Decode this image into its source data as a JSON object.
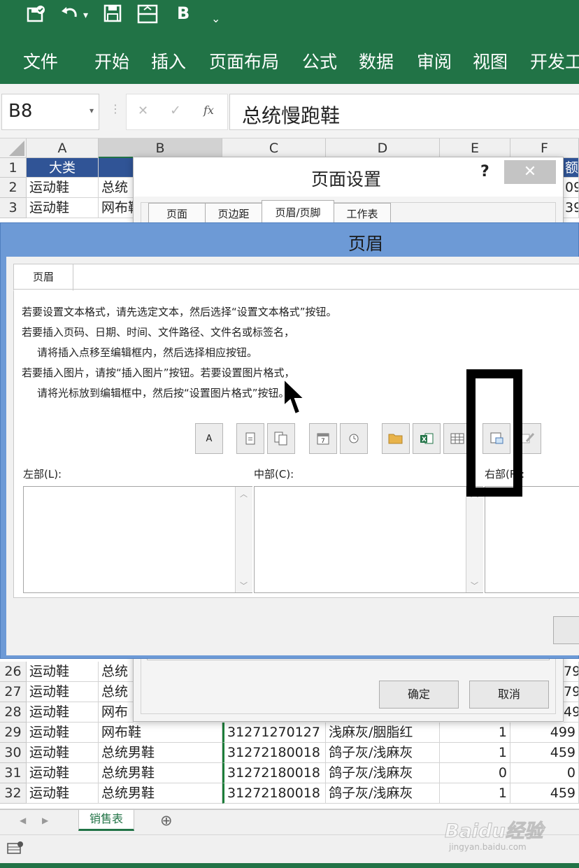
{
  "qat": {
    "save_icon": "save-icon",
    "undo_icon": "undo-icon",
    "bold_label": "B"
  },
  "ribbon": {
    "tabs": [
      "文件",
      "开始",
      "插入",
      "页面布局",
      "公式",
      "数据",
      "审阅",
      "视图",
      "开发工"
    ]
  },
  "formula_bar": {
    "name_box": "B8",
    "cancel": "✕",
    "enter": "✓",
    "fx": "fx",
    "value": "总统慢跑鞋"
  },
  "columns": [
    "A",
    "B",
    "C",
    "D",
    "E",
    "F"
  ],
  "rows_top": [
    {
      "n": "1",
      "a": "大类",
      "b": "",
      "f": "额"
    },
    {
      "n": "2",
      "a": "运动鞋",
      "b": "总统",
      "f": "09"
    },
    {
      "n": "3",
      "a": "运动鞋",
      "b": "网布鞋",
      "f": "39"
    }
  ],
  "rows_bottom": [
    {
      "n": "26",
      "a": "运动鞋",
      "b": "总统",
      "c": "",
      "d": "",
      "e": "",
      "f": "79"
    },
    {
      "n": "27",
      "a": "运动鞋",
      "b": "总统",
      "c": "",
      "d": "",
      "e": "",
      "f": "79"
    },
    {
      "n": "28",
      "a": "运动鞋",
      "b": "网布",
      "c": "",
      "d": "",
      "e": "",
      "f": "49"
    },
    {
      "n": "29",
      "a": "运动鞋",
      "b": "网布鞋",
      "c": "31271270127",
      "d": "浅麻灰/胭脂红",
      "e": "1",
      "f": "499"
    },
    {
      "n": "30",
      "a": "运动鞋",
      "b": "总统男鞋",
      "c": "31272180018",
      "d": "鸽子灰/浅麻灰",
      "e": "1",
      "f": "459"
    },
    {
      "n": "31",
      "a": "运动鞋",
      "b": "总统男鞋",
      "c": "31272180018",
      "d": "鸽子灰/浅麻灰",
      "e": "0",
      "f": "0"
    },
    {
      "n": "32",
      "a": "运动鞋",
      "b": "总统男鞋",
      "c": "31272180018",
      "d": "鸽子灰/浅麻灰",
      "e": "1",
      "f": "459"
    }
  ],
  "sheet_tabs": {
    "active": "销售表",
    "add": "⊕"
  },
  "page_setup": {
    "title": "页面设置",
    "help": "?",
    "close": "✕",
    "tabs": [
      "页面",
      "页边距",
      "页眉/页脚",
      "工作表"
    ],
    "ok": "确定",
    "cancel": "取消"
  },
  "header_dialog": {
    "title": "页眉",
    "tab": "页眉",
    "instructions": [
      "若要设置文本格式，请先选定文本，然后选择“设置文本格式”按钮。",
      "若要插入页码、日期、时间、文件路径、文件名或标签名，",
      "请将插入点移至编辑框内，然后选择相应按钮。",
      "若要插入图片，请按“插入图片”按钮。若要设置图片格式，",
      "请将光标放到编辑框中，然后按“设置图片格式”按钮。"
    ],
    "toolbar": [
      "format-text-icon",
      "page-number-icon",
      "page-count-icon",
      "date-icon",
      "time-icon",
      "file-path-icon",
      "file-name-icon",
      "sheet-name-icon",
      "insert-picture-icon",
      "format-picture-icon"
    ],
    "format_text_glyph": "A",
    "left_label": "左部(L):",
    "center_label": "中部(C):",
    "right_label": "右部(R):"
  },
  "watermark": {
    "brand": "Baidu经验",
    "url": "jingyan.baidu.com"
  }
}
